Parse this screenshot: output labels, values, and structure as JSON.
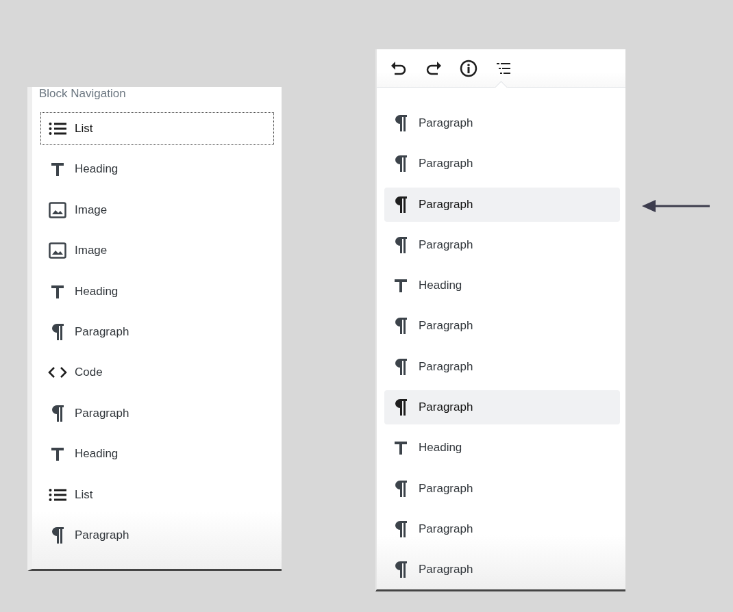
{
  "block_navigation": {
    "title": "Block Navigation",
    "items": [
      {
        "kind": "list",
        "label": "List",
        "focused": true
      },
      {
        "kind": "heading",
        "label": "Heading",
        "focused": false
      },
      {
        "kind": "image",
        "label": "Image",
        "focused": false
      },
      {
        "kind": "image",
        "label": "Image",
        "focused": false
      },
      {
        "kind": "heading",
        "label": "Heading",
        "focused": false
      },
      {
        "kind": "paragraph",
        "label": "Paragraph",
        "focused": false
      },
      {
        "kind": "code",
        "label": "Code",
        "focused": false
      },
      {
        "kind": "paragraph",
        "label": "Paragraph",
        "focused": false
      },
      {
        "kind": "heading",
        "label": "Heading",
        "focused": false
      },
      {
        "kind": "list",
        "label": "List",
        "focused": false
      },
      {
        "kind": "paragraph",
        "label": "Paragraph",
        "focused": false
      }
    ]
  },
  "editor_panel": {
    "toolbar": [
      {
        "kind": "undo"
      },
      {
        "kind": "redo"
      },
      {
        "kind": "info"
      },
      {
        "kind": "outline"
      }
    ],
    "items": [
      {
        "kind": "paragraph",
        "label": "Paragraph",
        "selected": false
      },
      {
        "kind": "paragraph",
        "label": "Paragraph",
        "selected": false
      },
      {
        "kind": "paragraph",
        "label": "Paragraph",
        "selected": true
      },
      {
        "kind": "paragraph",
        "label": "Paragraph",
        "selected": false
      },
      {
        "kind": "heading",
        "label": "Heading",
        "selected": false
      },
      {
        "kind": "paragraph",
        "label": "Paragraph",
        "selected": false
      },
      {
        "kind": "paragraph",
        "label": "Paragraph",
        "selected": false
      },
      {
        "kind": "paragraph",
        "label": "Paragraph",
        "selected": true
      },
      {
        "kind": "heading",
        "label": "Heading",
        "selected": false
      },
      {
        "kind": "paragraph",
        "label": "Paragraph",
        "selected": false
      },
      {
        "kind": "paragraph",
        "label": "Paragraph",
        "selected": false
      },
      {
        "kind": "paragraph",
        "label": "Paragraph",
        "selected": false
      }
    ]
  }
}
